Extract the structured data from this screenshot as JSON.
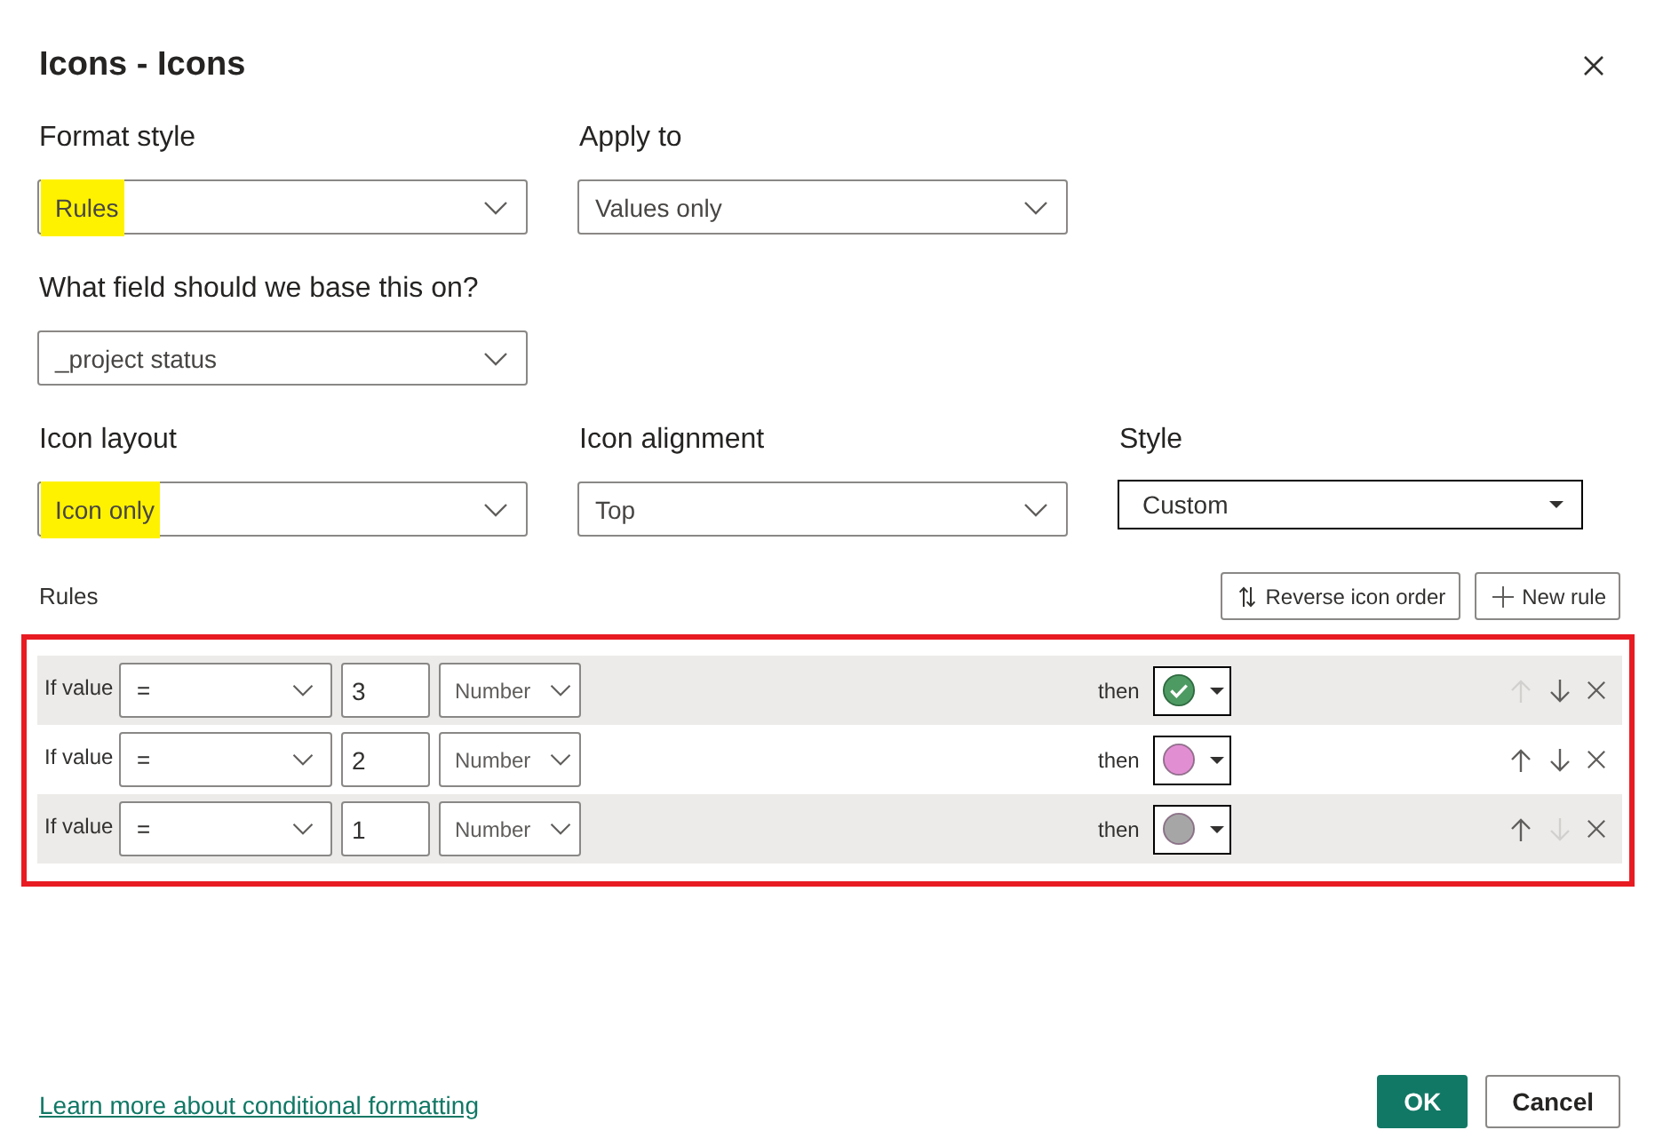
{
  "dialog": {
    "title": "Icons - Icons"
  },
  "field_rows": [
    [
      {
        "kind": "dropdown",
        "label": "Format style",
        "value": "Rules",
        "highlighted": true
      },
      {
        "kind": "dropdown",
        "label": "Apply to",
        "value": "Values only",
        "highlighted": false
      }
    ],
    [
      {
        "kind": "dropdown",
        "label": "What field should we base this on?",
        "value": "_project status",
        "highlighted": false
      }
    ],
    [
      {
        "kind": "dropdown",
        "label": "Icon layout",
        "value": "Icon only",
        "highlighted": true
      },
      {
        "kind": "dropdown",
        "label": "Icon alignment",
        "value": "Top",
        "highlighted": false
      },
      {
        "kind": "combo",
        "label": "Style",
        "value": "Custom",
        "highlighted": false
      }
    ]
  ],
  "rules": {
    "label": "Rules",
    "annotation_frame": true,
    "buttons": [
      {
        "kind": "reverse",
        "label": "Reverse icon order"
      },
      {
        "kind": "add",
        "label": "New rule"
      }
    ],
    "items": [
      {
        "condition": "If value",
        "operator": "=",
        "value": "3",
        "value_type": "Number",
        "then": "then",
        "icon": {
          "kind": "check",
          "color": "#4e9a63"
        },
        "up_disabled": true,
        "down_disabled": false
      },
      {
        "condition": "If value",
        "operator": "=",
        "value": "2",
        "value_type": "Number",
        "then": "then",
        "icon": {
          "kind": "circle",
          "color": "#e18fd2"
        },
        "up_disabled": false,
        "down_disabled": false
      },
      {
        "condition": "If value",
        "operator": "=",
        "value": "1",
        "value_type": "Number",
        "then": "then",
        "icon": {
          "kind": "circle",
          "color": "#a6a6a6"
        },
        "up_disabled": false,
        "down_disabled": true
      }
    ]
  },
  "footer": {
    "link": "Learn more about conditional formatting",
    "buttons": [
      {
        "kind": "primary",
        "label": "OK"
      },
      {
        "kind": "secondary",
        "label": "Cancel"
      }
    ]
  }
}
